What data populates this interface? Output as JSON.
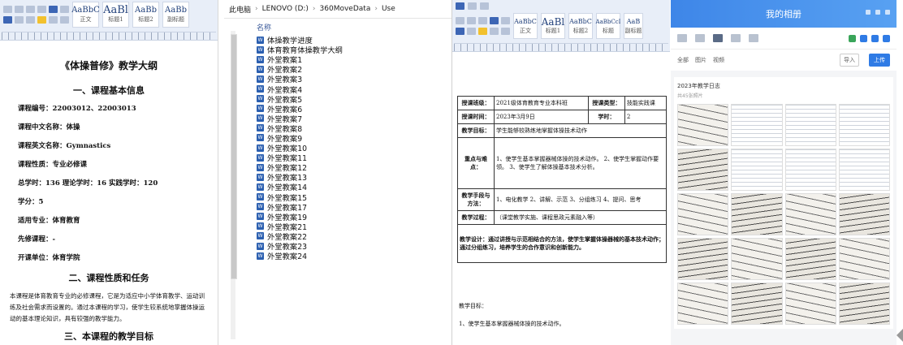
{
  "panel1": {
    "ribbon_styles": [
      {
        "sample": "AaBbC",
        "name": "正文"
      },
      {
        "sample": "AaBl",
        "name": "标题1"
      },
      {
        "sample": "AaBb",
        "name": "标题2"
      },
      {
        "sample": "AaBb",
        "name": "副标题"
      }
    ],
    "doc_title": "《体操普修》教学大纲",
    "section1": "一、课程基本信息",
    "fields": [
      "课程编号：22003012、22003013",
      "课程中文名称：体操",
      "课程英文名称：Gymnastics",
      "课程性质：专业必修课",
      "总学时：136    理论学时：16  实践学时：120",
      "学分：5",
      "适用专业：体育教育",
      "先修课程：-",
      "开课单位：体育学院"
    ],
    "section2": "二、课程性质和任务",
    "paragraph": "本课程是体育教育专业的必修课程，它是为适应中小学体育教学、运动训练及社会需求而设置的。通过本课程的学习，使学生较系统地掌握体操运动的基本理论知识，具有较强的教学能力。",
    "section3": "三、本课程的教学目标"
  },
  "panel2": {
    "breadcrumb": [
      "此电脑",
      "LENOVO (D:)",
      "360MoveData",
      "Use"
    ],
    "column_header": "名称",
    "files": [
      "体操教学进度",
      "体育教育体操教学大纲",
      "外堂教案1",
      "外堂教案2",
      "外堂教案3",
      "外堂教案4",
      "外堂教案5",
      "外堂教案6",
      "外堂教案7",
      "外堂教案8",
      "外堂教案9",
      "外堂教案10",
      "外堂教案11",
      "外堂教案12",
      "外堂教案13",
      "外堂教案14",
      "外堂教案15",
      "外堂教案17",
      "外堂教案19",
      "外堂教案21",
      "外堂教案22",
      "外堂教案23",
      "外堂教案24"
    ]
  },
  "panel3": {
    "ribbon_styles": [
      {
        "sample": "AaBbC",
        "name": "正文"
      },
      {
        "sample": "AaBl",
        "name": "标题1"
      },
      {
        "sample": "AaBbC",
        "name": "标题2"
      },
      {
        "sample": "AaBbCcI",
        "name": "标题"
      },
      {
        "sample": "AaB",
        "name": "副标题"
      }
    ],
    "rows": [
      {
        "k": "授课班级：",
        "v": "2021级体育教育专业本科班",
        "k2": "授课类型：",
        "v2": "技能实践课"
      },
      {
        "k": "授课时间：",
        "v": "2023年3月9日",
        "k2": "学时：",
        "v2": "2"
      },
      {
        "k": "教学目标：",
        "v": "学生能够较熟练地掌握体操技术动作"
      },
      {
        "k": "重点与难点：",
        "v": "1、使学生基本掌握器械体操的技术动作。 2、使学生掌握动作要领。 3、使学生了解体操基本技术分析。"
      },
      {
        "k": "教学手段与方法：",
        "v": "1、电化教学  2、讲解、示范  3、分组练习  4、提问、思考"
      },
      {
        "k": "教学过程：",
        "v": "（课堂教学实施、课程思政元素融入等）"
      }
    ],
    "process_text": "教学设计：通过讲授与示范相结合的方法，使学生掌握体操器械的基本技术动作；通过分组练习，培养学生的合作意识和创新能力。",
    "footer_label": "教学目标：",
    "footer_item": "1、使学生基本掌握器械体操的技术动作。"
  },
  "panel4": {
    "app_title": "我的相册",
    "toolbar2_left": [
      "全部",
      "图片",
      "视频"
    ],
    "btn_import": "导入",
    "btn_upload": "上传",
    "album_title": "2023年教学日志",
    "album_sub": "共45张照片"
  }
}
